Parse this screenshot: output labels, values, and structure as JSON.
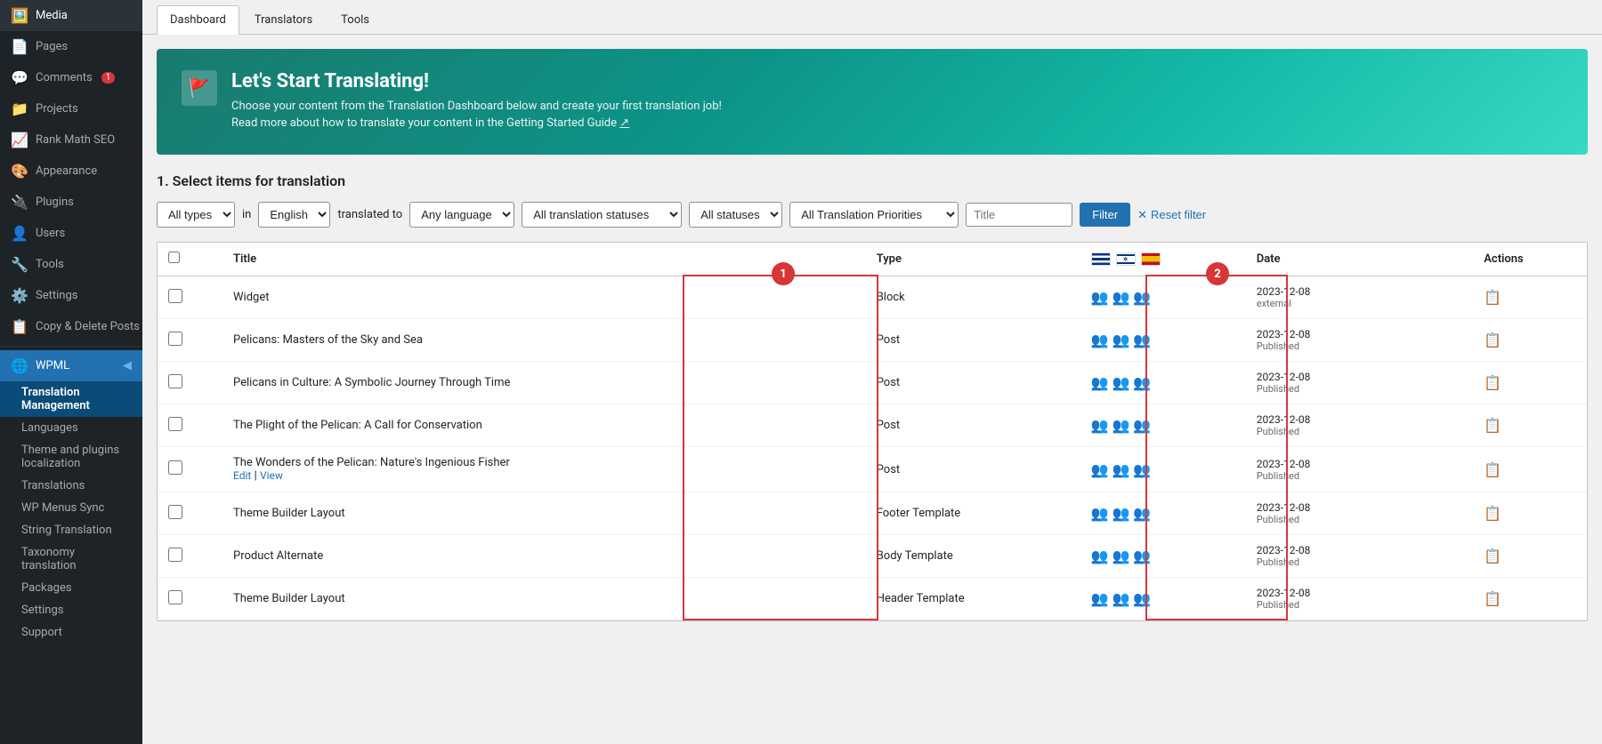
{
  "sidebar": {
    "items": [
      {
        "id": "media",
        "label": "Media",
        "icon": "🖼️",
        "badge": null
      },
      {
        "id": "pages",
        "label": "Pages",
        "icon": "📄",
        "badge": null
      },
      {
        "id": "comments",
        "label": "Comments",
        "icon": "💬",
        "badge": "1"
      },
      {
        "id": "projects",
        "label": "Projects",
        "icon": "📁",
        "badge": null
      },
      {
        "id": "rank-math-seo",
        "label": "Rank Math SEO",
        "icon": "📈",
        "badge": null
      },
      {
        "id": "appearance",
        "label": "Appearance",
        "icon": "🎨",
        "badge": null
      },
      {
        "id": "plugins",
        "label": "Plugins",
        "icon": "🔌",
        "badge": null
      },
      {
        "id": "users",
        "label": "Users",
        "icon": "👤",
        "badge": null
      },
      {
        "id": "tools",
        "label": "Tools",
        "icon": "🔧",
        "badge": null
      },
      {
        "id": "settings",
        "label": "Settings",
        "icon": "⚙️",
        "badge": null
      },
      {
        "id": "copy-delete-posts",
        "label": "Copy & Delete Posts",
        "icon": "📋",
        "badge": null
      }
    ],
    "wpml": {
      "label": "WPML",
      "sub_items": [
        {
          "id": "translation-management",
          "label": "Translation Management",
          "active": true
        },
        {
          "id": "languages",
          "label": "Languages"
        },
        {
          "id": "theme-plugins-localization",
          "label": "Theme and plugins localization"
        },
        {
          "id": "translations",
          "label": "Translations"
        },
        {
          "id": "wp-menus-sync",
          "label": "WP Menus Sync"
        },
        {
          "id": "string-translation",
          "label": "String Translation"
        },
        {
          "id": "taxonomy-translation",
          "label": "Taxonomy translation"
        },
        {
          "id": "packages",
          "label": "Packages"
        },
        {
          "id": "settings-wpml",
          "label": "Settings"
        },
        {
          "id": "support",
          "label": "Support"
        }
      ]
    }
  },
  "tabs": [
    {
      "id": "dashboard",
      "label": "Dashboard",
      "active": true
    },
    {
      "id": "translators",
      "label": "Translators"
    },
    {
      "id": "tools",
      "label": "Tools"
    }
  ],
  "banner": {
    "icon": "🚩",
    "title": "Let's Start Translating!",
    "line1": "Choose your content from the Translation Dashboard below and create your first translation job!",
    "line2": "Read more about how to translate your content in the Getting Started Guide",
    "link_text": "Getting Started Guide"
  },
  "section": {
    "title": "1. Select items for translation"
  },
  "filters": {
    "types_label": "All types",
    "in_label": "in",
    "language_label": "English",
    "translated_to_label": "translated to",
    "any_language_label": "Any language",
    "all_statuses_label": "All translation statuses",
    "all_statuses2_label": "All statuses",
    "priorities_label": "All Translation Priorities",
    "title_placeholder": "Title",
    "filter_btn": "Filter",
    "reset_btn": "Reset filter"
  },
  "table": {
    "headers": {
      "title": "Title",
      "type": "Type",
      "date": "Date",
      "actions": "Actions"
    },
    "highlight_circles": {
      "circle1": "1",
      "circle2": "2"
    },
    "rows": [
      {
        "id": 1,
        "title": "Widget",
        "type": "Block",
        "date": "2023-12-08",
        "status": "external",
        "highlighted": false
      },
      {
        "id": 2,
        "title": "Pelicans: Masters of the Sky and Sea",
        "type": "Post",
        "date": "2023-12-08",
        "status": "Published",
        "highlighted": false
      },
      {
        "id": 3,
        "title": "Pelicans in Culture: A Symbolic Journey Through Time",
        "type": "Post",
        "date": "2023-12-08",
        "status": "Published",
        "highlighted": false
      },
      {
        "id": 4,
        "title": "The Plight of the Pelican: A Call for Conservation",
        "type": "Post",
        "date": "2023-12-08",
        "status": "Published",
        "highlighted": false
      },
      {
        "id": 5,
        "title": "The Wonders of the Pelican: Nature's Ingenious Fisher",
        "type": "Post",
        "date": "2023-12-08",
        "status": "Published",
        "highlighted": false,
        "has_edit_view": true
      },
      {
        "id": 6,
        "title": "Theme Builder Layout",
        "type": "Footer Template",
        "date": "2023-12-08",
        "status": "Published",
        "highlighted": false
      },
      {
        "id": 7,
        "title": "Product Alternate",
        "type": "Body Template",
        "date": "2023-12-08",
        "status": "Published",
        "highlighted": false
      },
      {
        "id": 8,
        "title": "Theme Builder Layout",
        "type": "Header Template",
        "date": "2023-12-08",
        "status": "Published",
        "highlighted": false
      }
    ]
  }
}
